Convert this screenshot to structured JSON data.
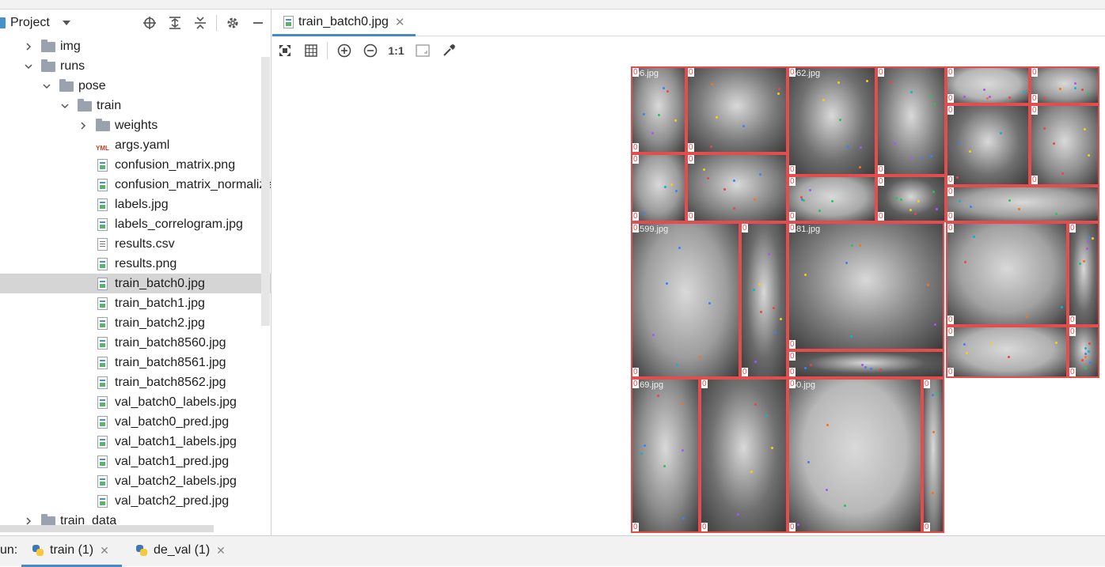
{
  "project_panel": {
    "title": "Project",
    "tree": [
      {
        "label": "img",
        "type": "folder",
        "depth": 1,
        "expanded": false
      },
      {
        "label": "runs",
        "type": "folder",
        "depth": 1,
        "expanded": true
      },
      {
        "label": "pose",
        "type": "folder",
        "depth": 2,
        "expanded": true
      },
      {
        "label": "train",
        "type": "folder",
        "depth": 3,
        "expanded": true
      },
      {
        "label": "weights",
        "type": "folder",
        "depth": 4,
        "expanded": false
      },
      {
        "label": "args.yaml",
        "type": "yaml",
        "depth": 4
      },
      {
        "label": "confusion_matrix.png",
        "type": "image",
        "depth": 4
      },
      {
        "label": "confusion_matrix_normalize",
        "type": "image",
        "depth": 4
      },
      {
        "label": "labels.jpg",
        "type": "image",
        "depth": 4
      },
      {
        "label": "labels_correlogram.jpg",
        "type": "image",
        "depth": 4
      },
      {
        "label": "results.csv",
        "type": "csv",
        "depth": 4
      },
      {
        "label": "results.png",
        "type": "image",
        "depth": 4
      },
      {
        "label": "train_batch0.jpg",
        "type": "image",
        "depth": 4,
        "selected": true
      },
      {
        "label": "train_batch1.jpg",
        "type": "image",
        "depth": 4
      },
      {
        "label": "train_batch2.jpg",
        "type": "image",
        "depth": 4
      },
      {
        "label": "train_batch8560.jpg",
        "type": "image",
        "depth": 4
      },
      {
        "label": "train_batch8561.jpg",
        "type": "image",
        "depth": 4
      },
      {
        "label": "train_batch8562.jpg",
        "type": "image",
        "depth": 4
      },
      {
        "label": "val_batch0_labels.jpg",
        "type": "image",
        "depth": 4
      },
      {
        "label": "val_batch0_pred.jpg",
        "type": "image",
        "depth": 4
      },
      {
        "label": "val_batch1_labels.jpg",
        "type": "image",
        "depth": 4
      },
      {
        "label": "val_batch1_pred.jpg",
        "type": "image",
        "depth": 4
      },
      {
        "label": "val_batch2_labels.jpg",
        "type": "image",
        "depth": 4
      },
      {
        "label": "val_batch2_pred.jpg",
        "type": "image",
        "depth": 4
      },
      {
        "label": "train_data",
        "type": "folder",
        "depth": 1,
        "expanded": false
      }
    ]
  },
  "editor": {
    "tab_label": "train_batch0.jpg",
    "toolbar": {
      "actual_size_label": "1:1"
    }
  },
  "image": {
    "tile_labels": [
      "06.jpg",
      "662.jpg",
      "1599.jpg",
      "481.jpg",
      "169.jpg",
      "60.jpg"
    ],
    "zero_label": "0"
  },
  "run_bar": {
    "label": "un:",
    "tabs": [
      {
        "label": "train (1)",
        "active": true
      },
      {
        "label": "de_val (1)",
        "active": false
      }
    ]
  },
  "colors": {
    "accent": "#4a88c7",
    "selection": "#d5d5d5",
    "box_outline": "#e34d4d",
    "folder": "#9aa3ad"
  }
}
